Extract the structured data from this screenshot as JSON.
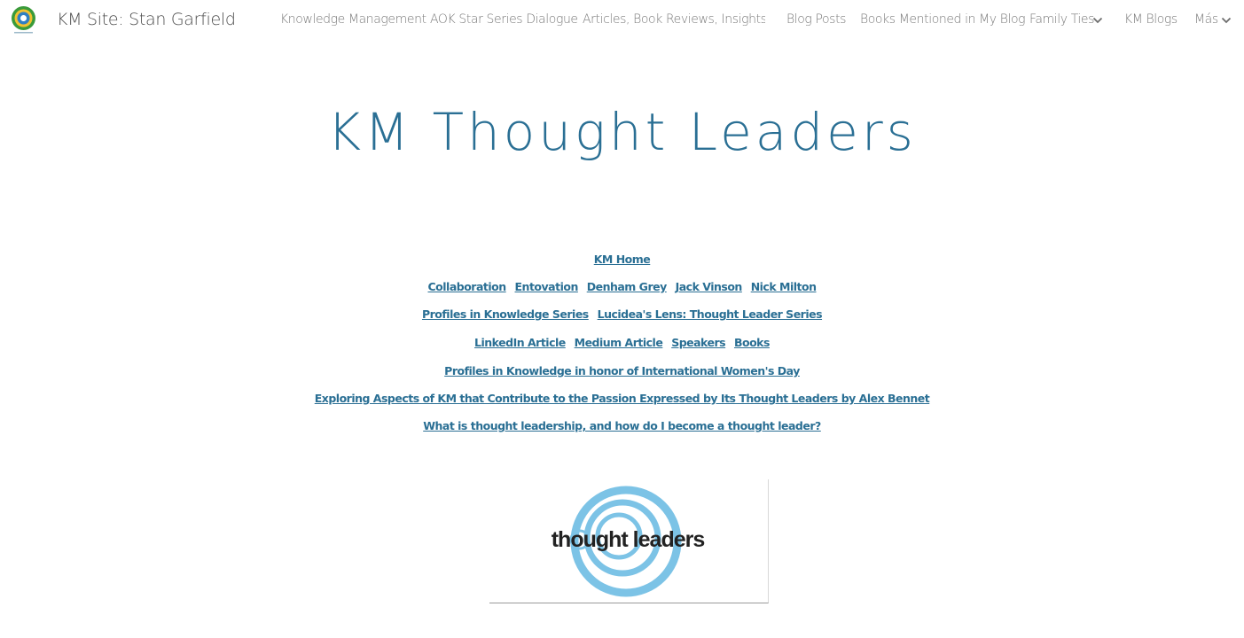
{
  "header": {
    "site_title": "KM Site: Stan Garfield",
    "logo_icon": "globe-circle-logo",
    "nav": [
      {
        "label": "Knowledge Management"
      },
      {
        "label": "AOK Star Series Dialogue"
      },
      {
        "label": "Articles, Book Reviews, Insights, …"
      },
      {
        "label": "Blog Posts"
      },
      {
        "label": "Books Mentioned in My Blog"
      },
      {
        "label": "Family Ties",
        "has_dropdown": true
      },
      {
        "label": "KM Blogs"
      },
      {
        "label": "Más",
        "has_dropdown": true
      }
    ]
  },
  "main": {
    "title": "KM Thought Leaders",
    "link_rows": [
      [
        "KM Home"
      ],
      [
        "Collaboration",
        "Entovation",
        "Denham Grey",
        "Jack Vinson",
        "Nick Milton"
      ],
      [
        "Profiles in Knowledge Series",
        "Lucidea's Lens: Thought Leader Series"
      ],
      [
        "LinkedIn Article",
        "Medium Article",
        "Speakers",
        "Books"
      ],
      [
        "Profiles in Knowledge in honor of International Women's Day"
      ],
      [
        "Exploring Aspects of KM that Contribute to the Passion Expressed by Its Thought Leaders by Alex Bennet"
      ],
      [
        "What is thought leadership, and how do I become a thought leader?"
      ]
    ],
    "image": {
      "logo_text": "thought leaders",
      "accent_color": "#7cc3e6"
    }
  },
  "colors": {
    "link": "#2a6f94",
    "title": "#2a6f94",
    "nav_text": "#7a7a7a"
  }
}
